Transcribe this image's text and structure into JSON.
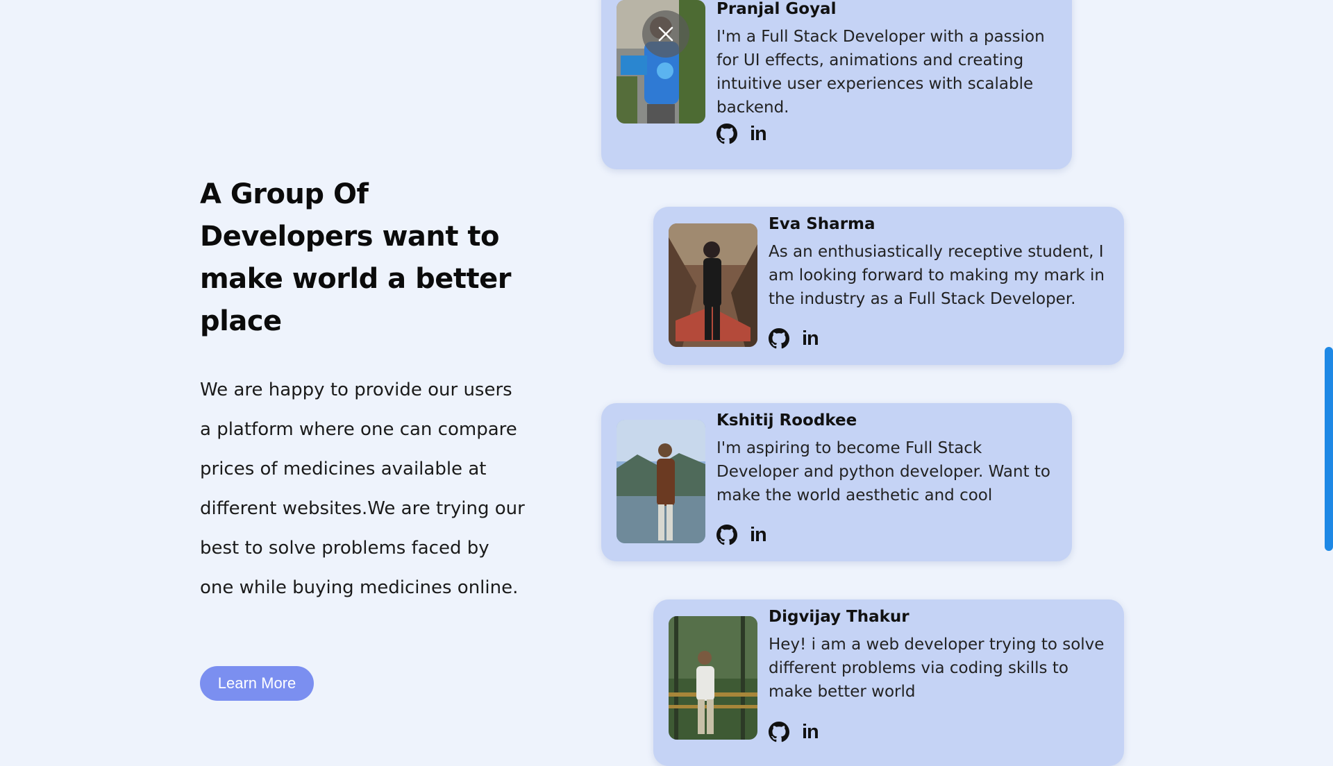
{
  "intro": {
    "heading": "A Group Of Developers want to make world a better place",
    "body": "We are happy to provide our users a platform where one can compare prices of medicines available at different websites.We are trying our best to solve problems faced by one while buying medicines online.",
    "button_label": "Learn More"
  },
  "cards": [
    {
      "name": "Pranjal Goyal",
      "bio": "I'm a Full Stack Developer with a passion for UI effects, animations and creating intuitive user experiences with scalable backend.",
      "linkedin_label": "in"
    },
    {
      "name": "Eva Sharma",
      "bio": "As an enthusiastically receptive student, I am looking forward to making my mark in the industry as a Full Stack Developer.",
      "linkedin_label": "in"
    },
    {
      "name": "Kshitij Roodkee",
      "bio": "I'm aspiring to become Full Stack Developer and python developer. Want to make the world aesthetic and cool",
      "linkedin_label": "in"
    },
    {
      "name": "Digvijay Thakur",
      "bio": "Hey! i am a web developer trying to solve different problems via coding skills to make better world",
      "linkedin_label": "in"
    }
  ],
  "icons": {
    "github": "github-icon",
    "linkedin": "linkedin-icon",
    "close": "close-icon"
  },
  "colors": {
    "page_background": "#eef3fc",
    "card_background": "#c5d3f5",
    "button_background": "#7b8ff0",
    "scrollbar": "#1e88e5"
  }
}
